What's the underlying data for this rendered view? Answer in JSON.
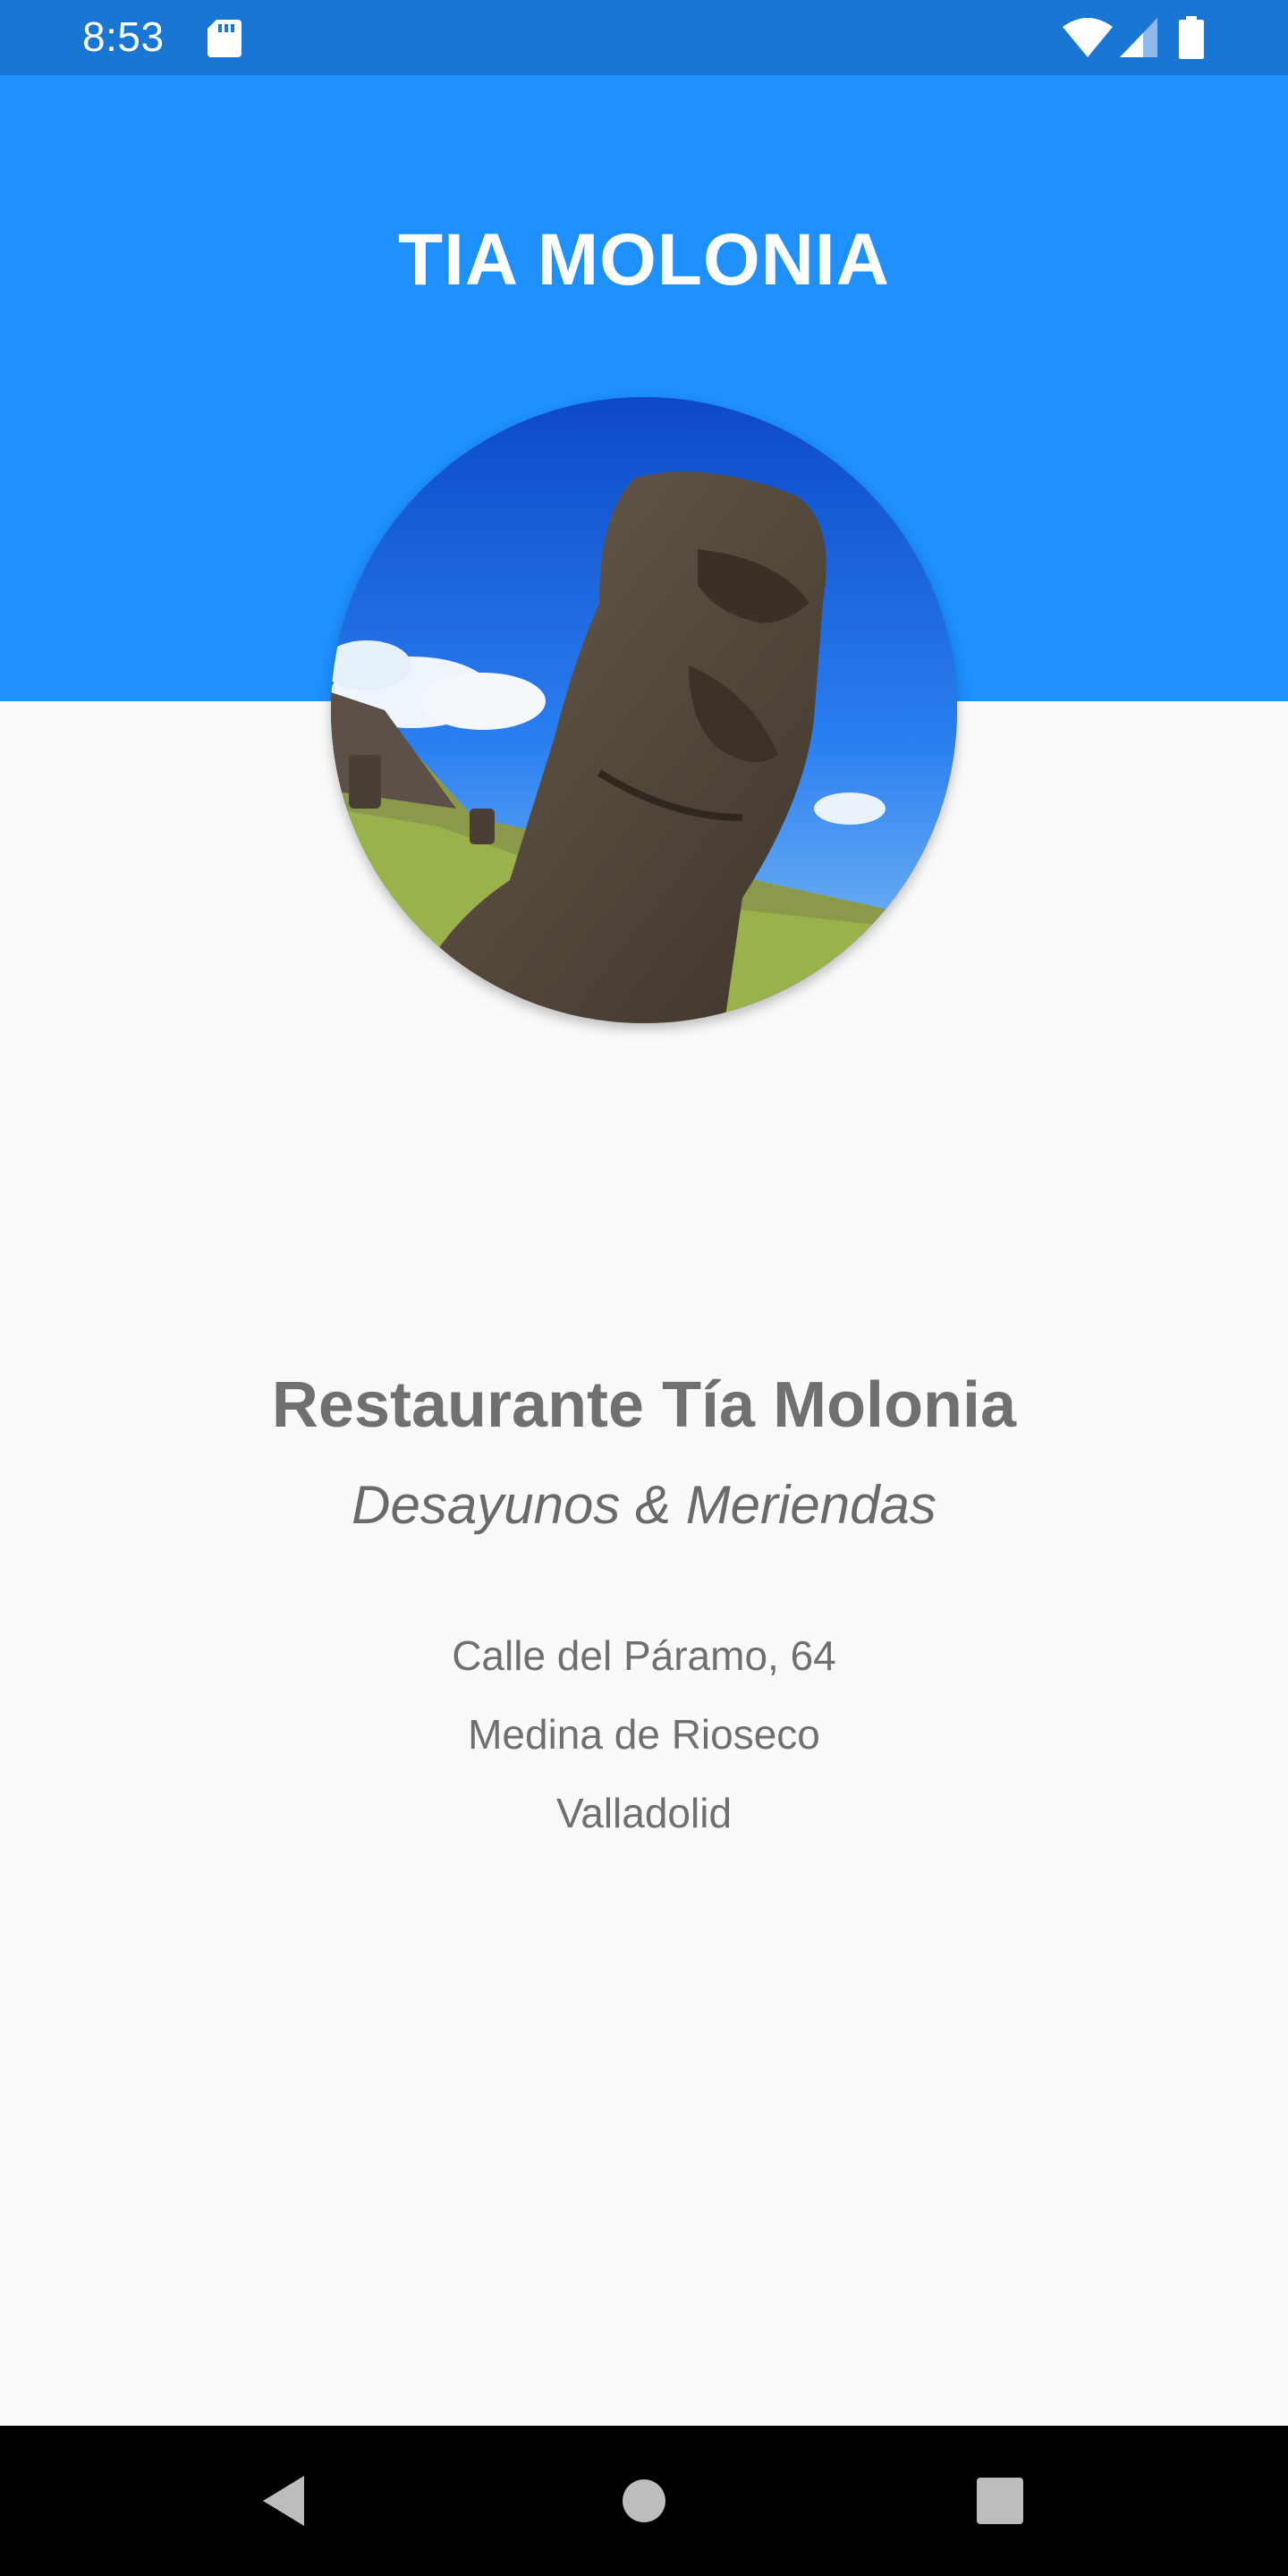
{
  "status_bar": {
    "time": "8:53",
    "icons": [
      "sd-card-icon",
      "wifi-icon",
      "signal-icon",
      "battery-icon"
    ],
    "background": "#1976d2"
  },
  "header": {
    "title": "TIA MOLONIA",
    "background": "#1e90ff"
  },
  "photo": {
    "subject": "moai-statue-photo"
  },
  "restaurant": {
    "name": "Restaurante Tía Molonia",
    "tagline": "Desayunos & Meriendas",
    "address": {
      "street": "Calle del Páramo, 64",
      "town": "Medina de Rioseco",
      "province": "Valladolid"
    }
  },
  "nav_bar": {
    "icons": [
      "back-icon",
      "home-icon",
      "recent-apps-icon"
    ]
  }
}
